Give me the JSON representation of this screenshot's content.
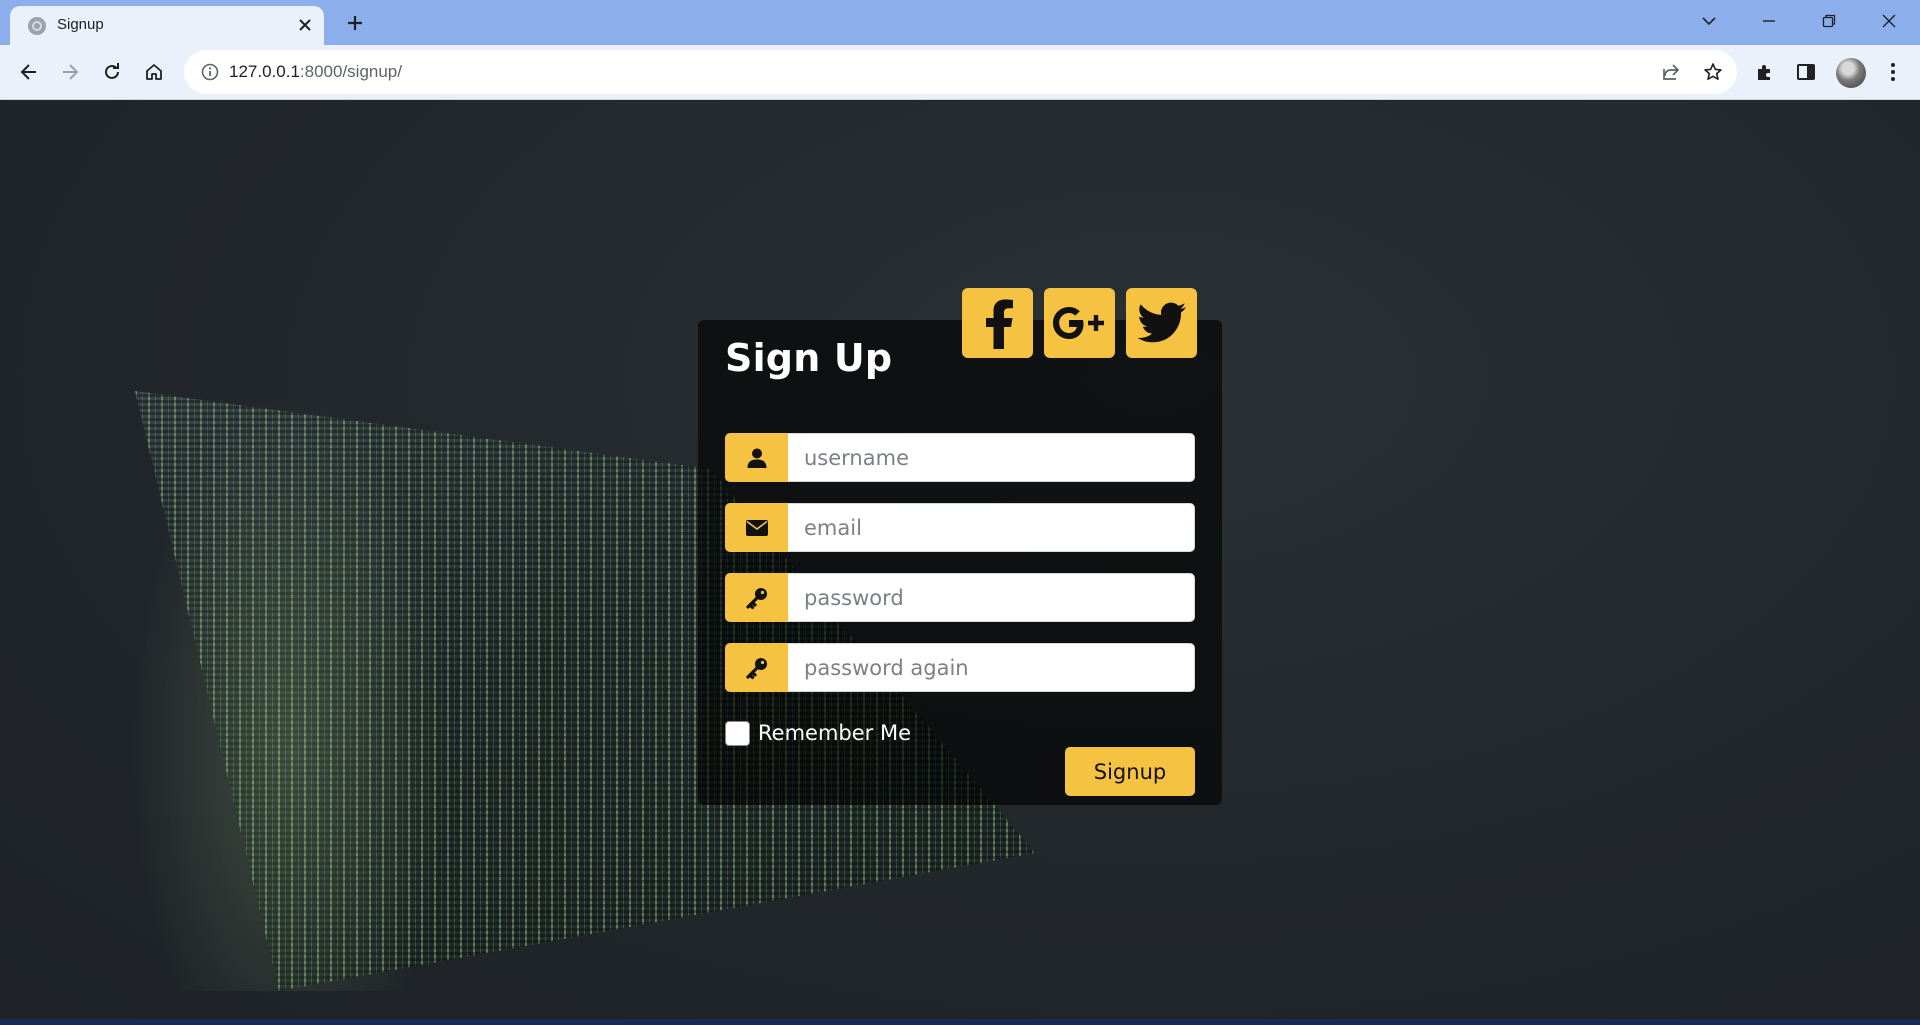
{
  "browser": {
    "tab_title": "Signup",
    "url_host": "127.0.0.1",
    "url_rest": ":8000/signup/",
    "icons": [
      "globe-icon",
      "close-icon",
      "plus-icon",
      "chevron-down-icon",
      "minimize-icon",
      "restore-icon",
      "window-close-icon",
      "back-icon",
      "forward-icon",
      "reload-icon",
      "home-icon",
      "info-icon",
      "share-icon",
      "star-icon",
      "extensions-icon",
      "sidepanel-icon",
      "menu-icon"
    ]
  },
  "form": {
    "title": "Sign Up",
    "fields": [
      {
        "placeholder": "username",
        "icon": "user-icon"
      },
      {
        "placeholder": "email",
        "icon": "envelope-icon"
      },
      {
        "placeholder": "password",
        "icon": "key-icon"
      },
      {
        "placeholder": "password again",
        "icon": "key-icon"
      }
    ],
    "remember_label": "Remember Me",
    "submit_label": "Signup",
    "socials": [
      "facebook-icon",
      "google-plus-icon",
      "twitter-icon"
    ]
  },
  "colors": {
    "accent": "#f5c242",
    "card_bg": "rgba(0,0,0,0.62)",
    "tabbar": "#8caeea",
    "toolbar": "#eaf1fb"
  }
}
